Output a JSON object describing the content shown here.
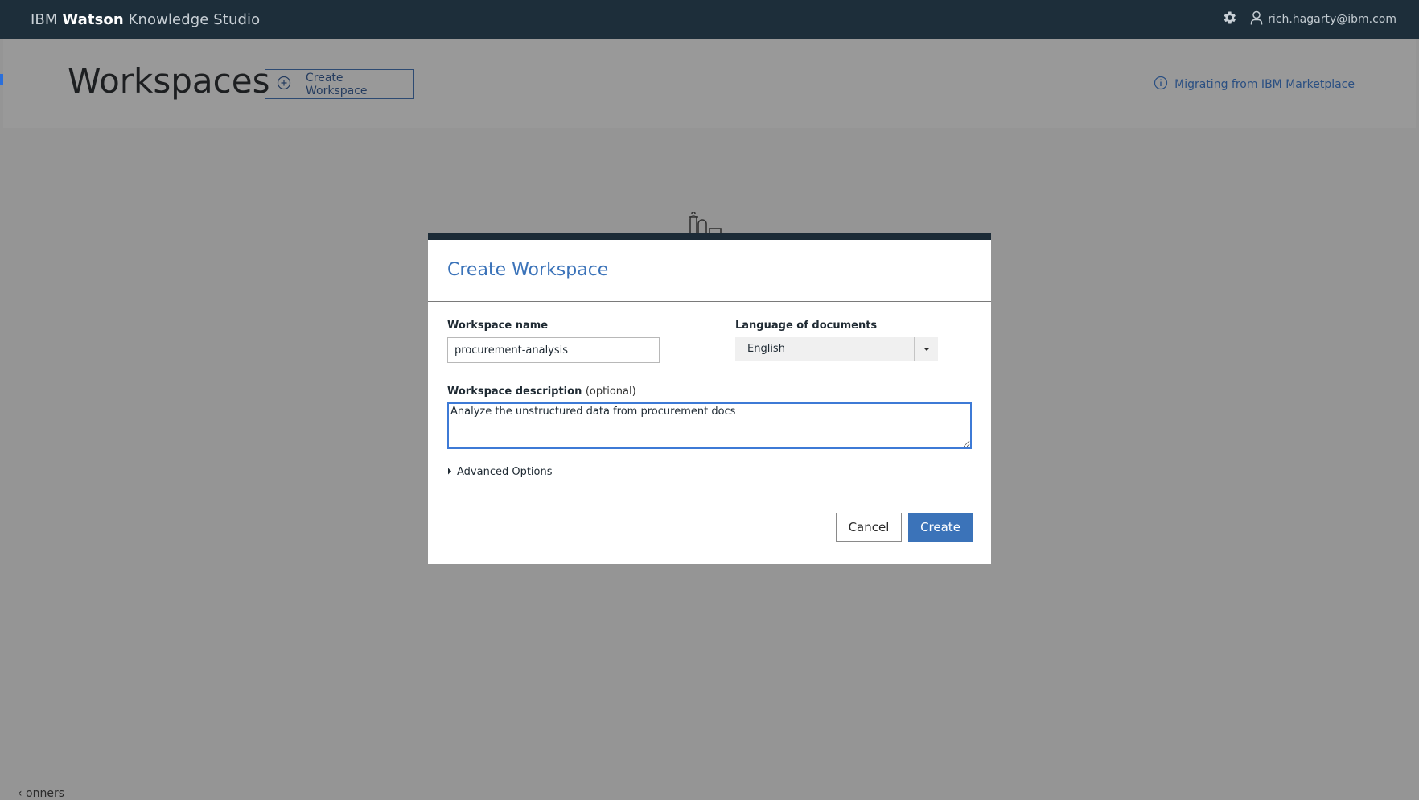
{
  "app": {
    "brand_prefix": "IBM ",
    "brand_bold": "Watson",
    "brand_suffix": " Knowledge Studio"
  },
  "topbar": {
    "settings_icon": "gear-icon",
    "user_icon": "user-icon",
    "user_email": "rich.hagarty@ibm.com"
  },
  "header": {
    "page_title": "Workspaces",
    "create_button_label": "Create Workspace",
    "migrate_link": "Migrating from IBM Marketplace"
  },
  "modal": {
    "title": "Create Workspace",
    "name_label": "Workspace name",
    "name_value": "procurement-analysis",
    "language_label": "Language of documents",
    "language_value": "English",
    "description_label": "Workspace description",
    "description_optional": "(optional)",
    "description_value": "Analyze the unstructured data from procurement docs",
    "advanced_options": "Advanced Options",
    "cancel_label": "Cancel",
    "create_label": "Create"
  },
  "background": {
    "bottom_fragment": "‹ onners"
  },
  "colors": {
    "topbar": "#1d2e3a",
    "accent_blue": "#3b73b9",
    "focus_blue": "#3d7ad6",
    "overlay_gray": "#959595"
  }
}
